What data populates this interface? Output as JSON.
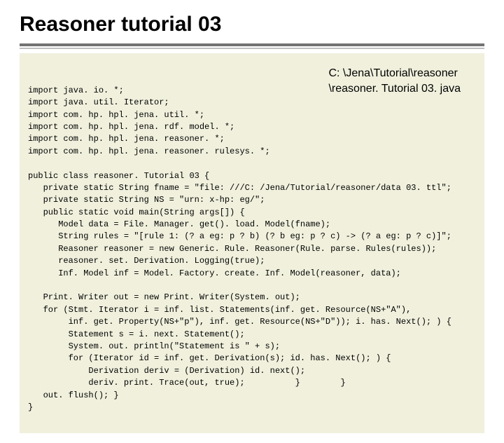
{
  "slide": {
    "title": "Reasoner tutorial 03"
  },
  "filepath": {
    "line1": "C: \\Jena\\Tutorial\\reasoner",
    "line2": "\\reasoner. Tutorial 03. java"
  },
  "code": {
    "imports": "import java. io. *;\nimport java. util. Iterator;\nimport com. hp. hpl. jena. util. *;\nimport com. hp. hpl. jena. rdf. model. *;\nimport com. hp. hpl. jena. reasoner. *;\nimport com. hp. hpl. jena. reasoner. rulesys. *;",
    "class_decl": "public class reasoner. Tutorial 03 {\n   private static String fname = \"file: ///C: /Jena/Tutorial/reasoner/data 03. ttl\";\n   private static String NS = \"urn: x-hp: eg/\";\n   public static void main(String args[]) {\n      Model data = File. Manager. get(). load. Model(fname);\n      String rules = \"[rule 1: (? a eg: p ? b) (? b eg: p ? c) -> (? a eg: p ? c)]\";\n      Reasoner reasoner = new Generic. Rule. Reasoner(Rule. parse. Rules(rules));\n      reasoner. set. Derivation. Logging(true);\n      Inf. Model inf = Model. Factory. create. Inf. Model(reasoner, data);",
    "body": "   Print. Writer out = new Print. Writer(System. out);\n   for (Stmt. Iterator i = inf. list. Statements(inf. get. Resource(NS+\"A\"),\n        inf. get. Property(NS+\"p\"), inf. get. Resource(NS+\"D\")); i. has. Next(); ) {\n        Statement s = i. next. Statement();\n        System. out. println(\"Statement is \" + s);\n        for (Iterator id = inf. get. Derivation(s); id. has. Next(); ) {\n            Derivation deriv = (Derivation) id. next();\n            deriv. print. Trace(out, true);          }        }\n   out. flush(); }\n}"
  }
}
